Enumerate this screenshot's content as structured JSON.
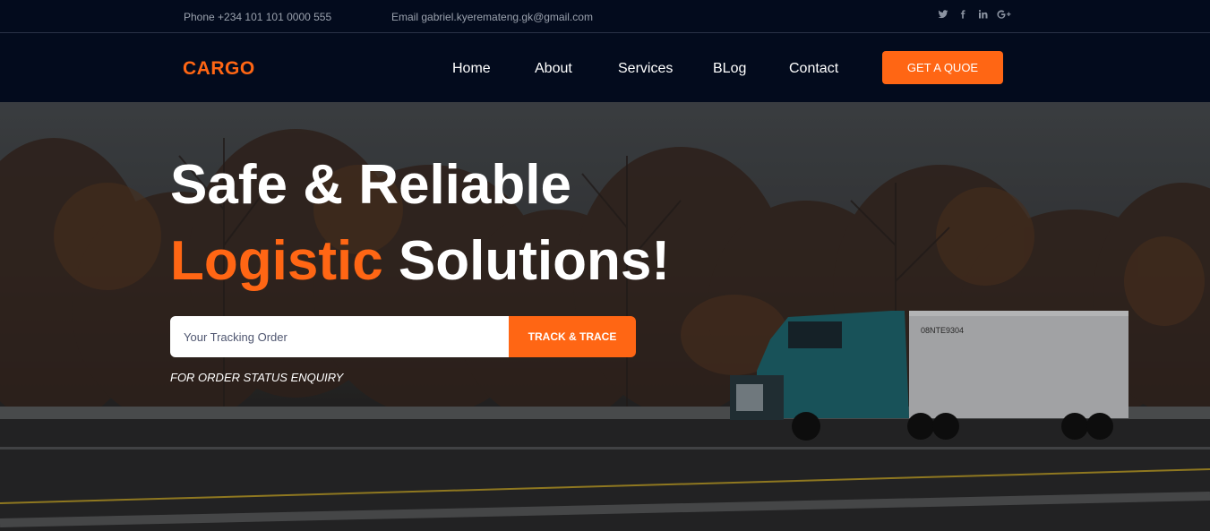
{
  "topbar": {
    "phone": "Phone +234 101 101 0000 555",
    "email": "Email gabriel.kyeremateng.gk@gmail.com",
    "social": [
      {
        "icon": "twitter-icon",
        "glyph": "t"
      },
      {
        "icon": "facebook-icon",
        "glyph": "f"
      },
      {
        "icon": "linkedin-icon",
        "glyph": "in"
      },
      {
        "icon": "google-plus-icon",
        "glyph": "G+"
      }
    ]
  },
  "nav": {
    "logo": "CARGO",
    "links": [
      "Home",
      "About",
      "Services",
      "BLog",
      "Contact"
    ],
    "quote_label": "GET A QUOE"
  },
  "hero": {
    "title_line1": "Safe & Reliable",
    "title_accent": "Logistic",
    "title_rest": " Solutions!",
    "tracking_placeholder": "Your Tracking Order",
    "track_label": "TRACK & TRACE",
    "enquiry_text": "FOR ORDER STATUS ENQUIRY",
    "truck_plate": "08NTE9304"
  },
  "colors": {
    "accent": "#ff6614",
    "navy": "#030b1d"
  }
}
